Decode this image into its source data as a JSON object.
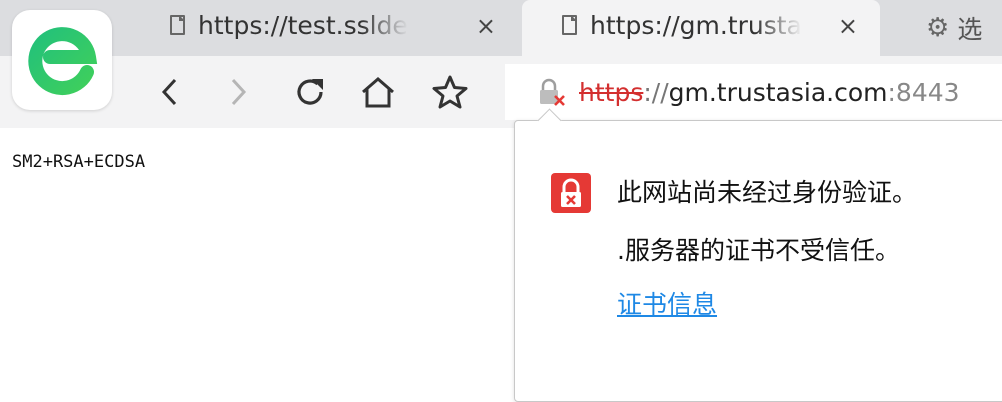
{
  "tabs": [
    {
      "title": "https://test.sslde",
      "close": "×",
      "icon": "page-icon"
    },
    {
      "title": "https://gm.trusta",
      "close": "×",
      "icon": "page-icon",
      "active": true
    },
    {
      "title": "选",
      "icon": "gear-icon"
    }
  ],
  "toolbar": {
    "back_icon": "back-arrow-icon",
    "forward_icon": "forward-arrow-icon",
    "reload_icon": "reload-icon",
    "home_icon": "home-icon",
    "bookmark_icon": "star-icon"
  },
  "address": {
    "scheme": "https",
    "separator": "://",
    "host": "gm.trustasia.com",
    "port": ":8443",
    "lock_icon": "insecure-lock-icon"
  },
  "page": {
    "body_text": "SM2+RSA+ECDSA"
  },
  "popup": {
    "line1": "此网站尚未经过身份验证。",
    "line2": ".服务器的证书不受信任。",
    "link": "证书信息",
    "warning_icon": "insecure-warning-icon"
  },
  "colors": {
    "brand_green": "#2fc46b",
    "error_red": "#e53935",
    "link_blue": "#1e88e5",
    "tab_strip": "#dcdde0",
    "toolbar": "#f3f3f4"
  }
}
